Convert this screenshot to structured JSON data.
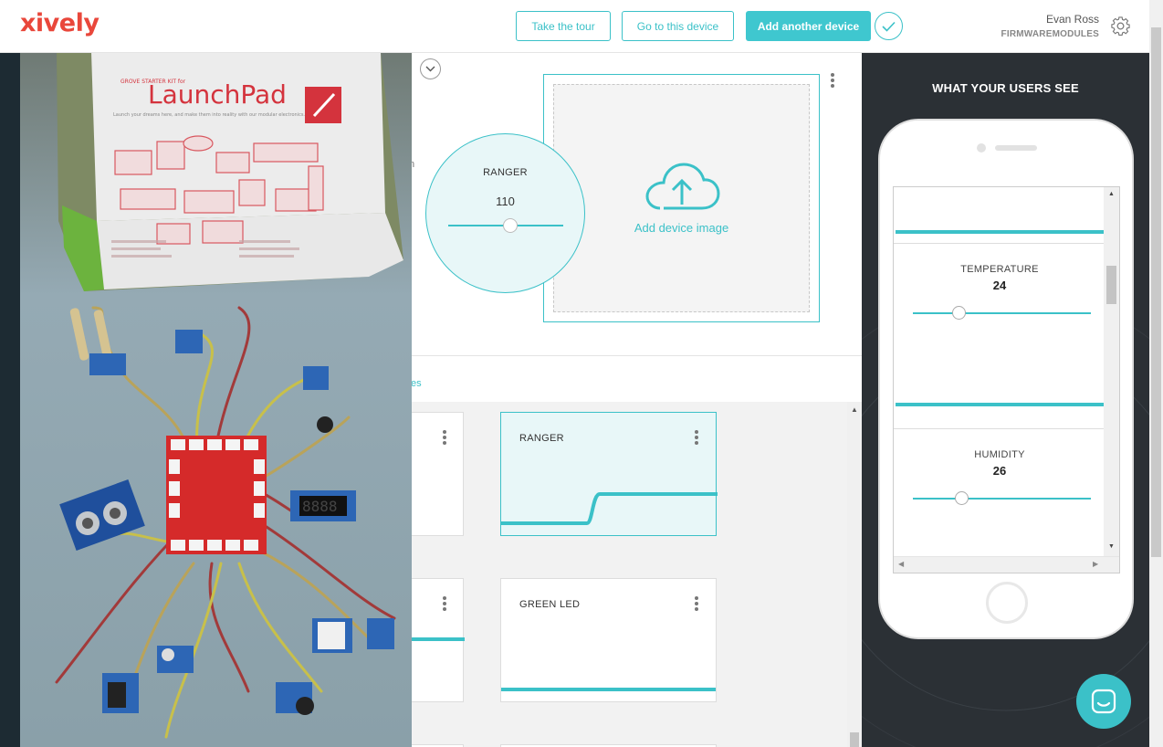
{
  "header": {
    "logo": "xively",
    "tour_button": "Take the tour",
    "device_button": "Go to this device",
    "add_button": "Add another device",
    "user_name": "Evan Ross",
    "user_org": "FIRMWAREMODULES"
  },
  "device_panel": {
    "partial_text": "n",
    "partial_link": "es",
    "image_upload_label": "Add device image",
    "ranger_bubble": {
      "name": "RANGER",
      "value": "110",
      "slider_fraction": 0.55
    }
  },
  "cards": [
    {
      "title": "RANGER",
      "active": true
    },
    {
      "title": "GREEN LED",
      "active": false
    }
  ],
  "preview": {
    "heading": "WHAT YOUR USERS SEE",
    "widgets": [
      {
        "name": "TEMPERATURE",
        "value": "24",
        "slider_fraction": 0.24
      },
      {
        "name": "HUMIDITY",
        "value": "26",
        "slider_fraction": 0.26
      }
    ]
  },
  "photo": {
    "box_text_small": "GROVE STARTER KIT for",
    "box_text_big": "LaunchPad",
    "box_tagline": "Launch your dreams here, and make them into reality with our modular electronics.",
    "display_digits": "8888"
  },
  "colors": {
    "accent": "#3bc1c8",
    "brand": "#e9473b",
    "dark_panel": "#2b3035"
  }
}
